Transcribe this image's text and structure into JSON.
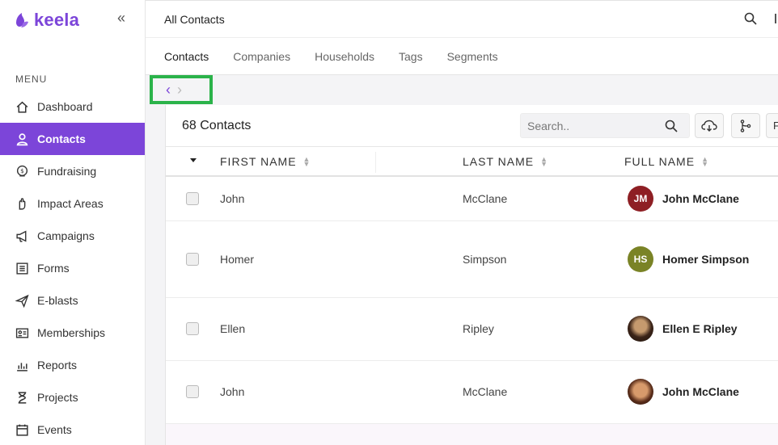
{
  "brand": {
    "name": "keela",
    "color": "#7c45d9"
  },
  "sidebar": {
    "menu_heading": "MENU",
    "items": [
      {
        "label": "Dashboard",
        "icon": "home-icon",
        "active": false
      },
      {
        "label": "Contacts",
        "icon": "user-icon",
        "active": true
      },
      {
        "label": "Fundraising",
        "icon": "hand-coin-icon",
        "active": false
      },
      {
        "label": "Impact Areas",
        "icon": "hand-heart-icon",
        "active": false
      },
      {
        "label": "Campaigns",
        "icon": "megaphone-icon",
        "active": false
      },
      {
        "label": "Forms",
        "icon": "form-icon",
        "active": false
      },
      {
        "label": "E-blasts",
        "icon": "send-icon",
        "active": false
      },
      {
        "label": "Memberships",
        "icon": "id-card-icon",
        "active": false
      },
      {
        "label": "Reports",
        "icon": "bar-chart-icon",
        "active": false
      },
      {
        "label": "Projects",
        "icon": "hourglass-icon",
        "active": false
      },
      {
        "label": "Events",
        "icon": "calendar-icon",
        "active": false
      }
    ]
  },
  "header": {
    "title": "All Contacts"
  },
  "tabs": [
    {
      "label": "Contacts",
      "active": true
    },
    {
      "label": "Companies",
      "active": false
    },
    {
      "label": "Households",
      "active": false
    },
    {
      "label": "Tags",
      "active": false
    },
    {
      "label": "Segments",
      "active": false
    }
  ],
  "pager": {
    "prev": "‹",
    "next": "›"
  },
  "list": {
    "count_label": "68 Contacts",
    "search_placeholder": "Search..",
    "partial_button": "F",
    "columns": [
      "FIRST NAME",
      "LAST NAME",
      "FULL NAME"
    ],
    "rows": [
      {
        "first": "John",
        "last": "McClane",
        "full": "John McClane",
        "initials": "JM",
        "avatar_color": "#8e1f24",
        "photo": false
      },
      {
        "first": "Homer",
        "last": "Simpson",
        "full": "Homer Simpson",
        "initials": "HS",
        "avatar_color": "#7a8326",
        "photo": false
      },
      {
        "first": "Ellen",
        "last": "Ripley",
        "full": "Ellen E Ripley",
        "initials": "",
        "avatar_color": "",
        "photo": true
      },
      {
        "first": "John",
        "last": "McClane",
        "full": "John McClane",
        "initials": "",
        "avatar_color": "",
        "photo": true
      }
    ]
  },
  "colors": {
    "accent": "#7c45d9",
    "highlight_border": "#2bb34a"
  }
}
